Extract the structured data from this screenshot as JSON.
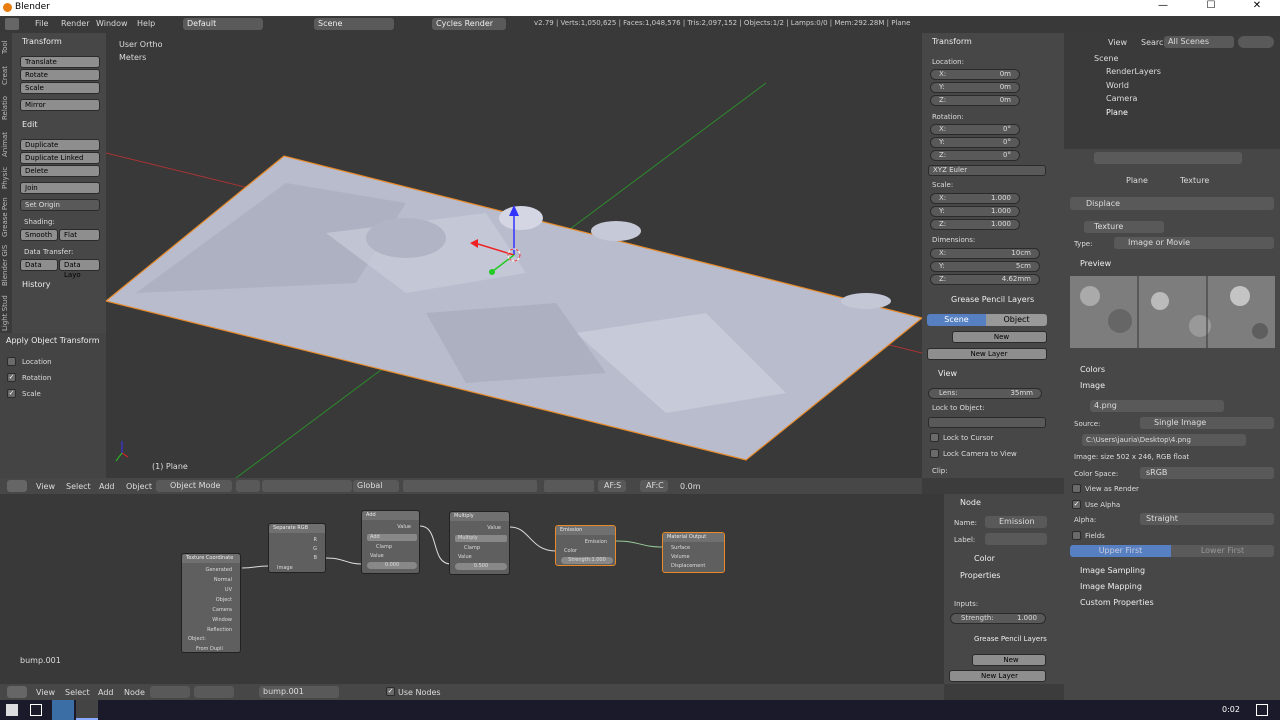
{
  "titlebar": {
    "title": "Blender",
    "min": "—",
    "max": "☐",
    "close": "✕"
  },
  "infobar": {
    "menus": [
      "File",
      "Render",
      "Window",
      "Help"
    ],
    "layout": "Default",
    "scene": "Scene",
    "engine": "Cycles Render",
    "stats": "v2.79 | Verts:1,050,625 | Faces:1,048,576 | Tris:2,097,152 | Objects:1/2 | Lamps:0/0 | Mem:292.28M | Plane"
  },
  "tool_tabs": [
    "Tool",
    "Creat",
    "Relatio",
    "Animat",
    "Physic",
    "Grease Pen",
    "Blender GIS",
    "Light Stud"
  ],
  "tools": {
    "transform": "Transform",
    "translate": "Translate",
    "rotate": "Rotate",
    "scale": "Scale",
    "mirror": "Mirror",
    "edit": "Edit",
    "duplicate": "Duplicate",
    "duplicate_linked": "Duplicate Linked",
    "delete": "Delete",
    "join": "Join",
    "set_origin": "Set Origin",
    "shading": "Shading:",
    "smooth": "Smooth",
    "flat": "Flat",
    "data_transfer": "Data Transfer:",
    "data": "Data",
    "data_layo": "Data Layo",
    "history": "History",
    "apply": "Apply Object Transform",
    "location": "Location",
    "rotation": "Rotation",
    "scale2": "Scale"
  },
  "viewport": {
    "view_label": "User Ortho",
    "units": "Meters",
    "object": "(1) Plane"
  },
  "viewport_header": {
    "view": "View",
    "select": "Select",
    "add": "Add",
    "object": "Object",
    "mode": "Object Mode",
    "orient": "Global",
    "afs": "AF:S",
    "afc": "AF:C",
    "val": "0.0m"
  },
  "npanel": {
    "transform": "Transform",
    "location": "Location:",
    "lx": "0m",
    "ly": "0m",
    "lz": "0m",
    "rotation": "Rotation:",
    "rx": "0°",
    "ry": "0°",
    "rz": "0°",
    "euler": "XYZ Euler",
    "scale": "Scale:",
    "sx": "1.000",
    "sy": "1.000",
    "sz": "1.000",
    "dimensions": "Dimensions:",
    "dx": "10cm",
    "dy": "5cm",
    "dz": "4.62mm",
    "gp": "Grease Pencil Layers",
    "scene": "Scene",
    "object": "Object",
    "new": "New",
    "new_layer": "New Layer",
    "view": "View",
    "lens": "Lens:",
    "lens_val": "35mm",
    "lock_obj": "Lock to Object:",
    "lock_cursor": "Lock to Cursor",
    "lock_cam": "Lock Camera to View",
    "clip": "Clip:"
  },
  "outliner": {
    "view": "View",
    "search": "Search",
    "filter": "All Scenes",
    "items": [
      "Scene",
      "RenderLayers",
      "World",
      "Camera",
      "Plane"
    ]
  },
  "props": {
    "crumb_plane": "Plane",
    "crumb_tex": "Texture",
    "displace": "Displace",
    "tex_name": "Texture",
    "type_label": "Type:",
    "type_val": "Image or Movie",
    "preview": "Preview",
    "colors": "Colors",
    "image": "Image",
    "img_name": "4.png",
    "source_label": "Source:",
    "source_val": "Single Image",
    "path": "C:\\Users\\jauria\\Desktop\\4.png",
    "img_info": "Image: size 502 x 246, RGB float",
    "cs_label": "Color Space:",
    "cs_val": "sRGB",
    "view_render": "View as Render",
    "use_alpha": "Use Alpha",
    "alpha_label": "Alpha:",
    "alpha_val": "Straight",
    "fields": "Fields",
    "upper": "Upper First",
    "lower": "Lower First",
    "sampling": "Image Sampling",
    "mapping": "Image Mapping",
    "custom": "Custom Properties"
  },
  "node_panel": {
    "node": "Node",
    "name_label": "Name:",
    "name_val": "Emission",
    "label_label": "Label:",
    "color": "Color",
    "properties": "Properties",
    "inputs": "Inputs:",
    "strength_label": "Strength:",
    "strength_val": "1.000",
    "gp": "Grease Pencil Layers",
    "new": "New",
    "new_layer": "New Layer"
  },
  "node_editor": {
    "material": "bump.001"
  },
  "node_header": {
    "view": "View",
    "select": "Select",
    "add": "Add",
    "node": "Node",
    "mat": "bump.001",
    "use_nodes": "Use Nodes"
  },
  "nodes": {
    "texcoord": "Texture Coordinate",
    "tc_outs": [
      "Generated",
      "Normal",
      "UV",
      "Object",
      "Camera",
      "Window",
      "Reflection"
    ],
    "tc_object": "Object:",
    "tc_dupli": "From Dupli",
    "seprgb": "Separate RGB",
    "image": "Image",
    "r": "R",
    "g": "G",
    "b": "B",
    "add": "Add",
    "add_op": "Add",
    "clamp": "Clamp",
    "value": "Value",
    "add_val": "0.000",
    "multiply": "Multiply",
    "mul_op": "Multiply",
    "mul_val": "0.500",
    "emission": "Emission",
    "color": "Color",
    "strength": "Strength:1.000",
    "matout": "Material Output",
    "surface": "Surface",
    "volume": "Volume",
    "displacement": "Displacement"
  },
  "taskbar": {
    "time": "0:02"
  }
}
